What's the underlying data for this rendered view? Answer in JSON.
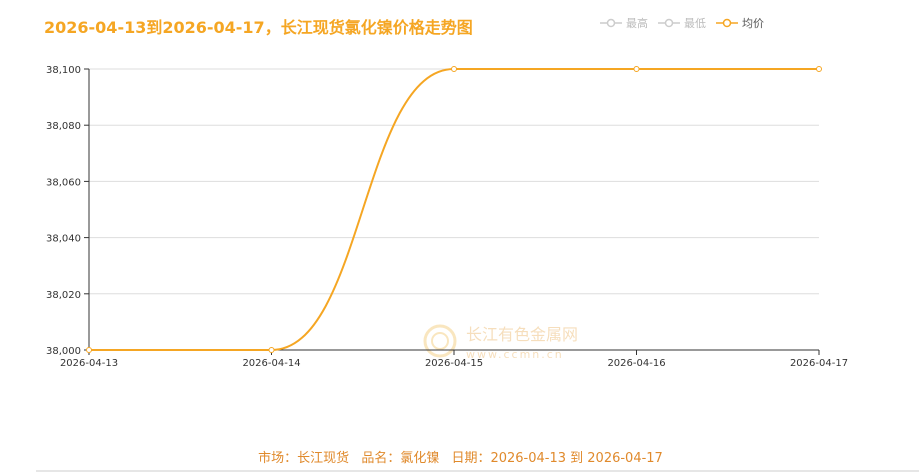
{
  "title": "2026-04-13到2026-04-17，长江现货氯化镍价格走势图",
  "legend": [
    {
      "label": "最高",
      "active": false
    },
    {
      "label": "最低",
      "active": false
    },
    {
      "label": "均价",
      "active": true
    }
  ],
  "watermark": {
    "text": "长江有色金属网",
    "sub": "www.ccmn.cn"
  },
  "footer": {
    "market": "市场：长江现货",
    "product": "品名：氯化镍",
    "date": "日期：2026-04-13 到 2026-04-17"
  },
  "colors": {
    "accent": "#f5a623",
    "grid": "#dddddd",
    "axis": "#333333",
    "footer_text": "#e08a2c"
  },
  "chart_data": {
    "type": "line",
    "title": "2026-04-13到2026-04-17，长江现货氯化镍价格走势图",
    "categories": [
      "2026-04-13",
      "2026-04-14",
      "2026-04-15",
      "2026-04-16",
      "2026-04-17"
    ],
    "series": [
      {
        "name": "最高",
        "values": [],
        "color": "#cccccc"
      },
      {
        "name": "最低",
        "values": [],
        "color": "#cccccc"
      },
      {
        "name": "均价",
        "values": [
          38000,
          38000,
          38100,
          38100,
          38100
        ],
        "color": "#f5a623"
      }
    ],
    "ylim": [
      38000,
      38100
    ],
    "yticks": [
      38000,
      38020,
      38040,
      38060,
      38080,
      38100
    ],
    "ytick_labels": [
      "38,000",
      "38,020",
      "38,040",
      "38,060",
      "38,080",
      "38,100"
    ],
    "grid": true,
    "legend_position": "top-right",
    "smooth": true
  }
}
